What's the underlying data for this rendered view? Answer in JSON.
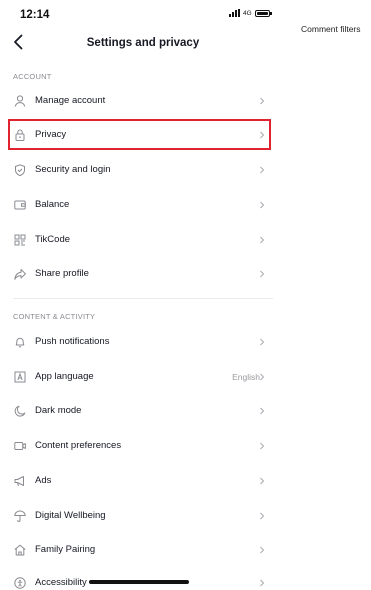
{
  "status_bar": {
    "time": "12:14",
    "network": "4G"
  },
  "header": {
    "title": "Settings and privacy"
  },
  "sections": [
    {
      "title": "ACCOUNT",
      "items": [
        {
          "label": "Manage account",
          "icon": "person-icon"
        },
        {
          "label": "Privacy",
          "icon": "lock-icon"
        },
        {
          "label": "Security and login",
          "icon": "shield-icon"
        },
        {
          "label": "Balance",
          "icon": "wallet-icon"
        },
        {
          "label": "TikCode",
          "icon": "qr-code-icon"
        },
        {
          "label": "Share profile",
          "icon": "share-icon"
        }
      ]
    },
    {
      "title": "CONTENT & ACTIVITY",
      "items": [
        {
          "label": "Push notifications",
          "icon": "bell-icon"
        },
        {
          "label": "App language",
          "icon": "language-icon",
          "value": "English"
        },
        {
          "label": "Dark mode",
          "icon": "moon-icon"
        },
        {
          "label": "Content preferences",
          "icon": "video-icon"
        },
        {
          "label": "Ads",
          "icon": "megaphone-icon"
        },
        {
          "label": "Digital Wellbeing",
          "icon": "umbrella-icon"
        },
        {
          "label": "Family Pairing",
          "icon": "house-icon"
        },
        {
          "label": "Accessibility",
          "icon": "accessibility-icon"
        }
      ]
    }
  ],
  "side_panel": {
    "label": "Comment filters"
  },
  "colors": {
    "highlight": "#e0242f",
    "text": "#161823",
    "muted": "#8a8b91"
  }
}
